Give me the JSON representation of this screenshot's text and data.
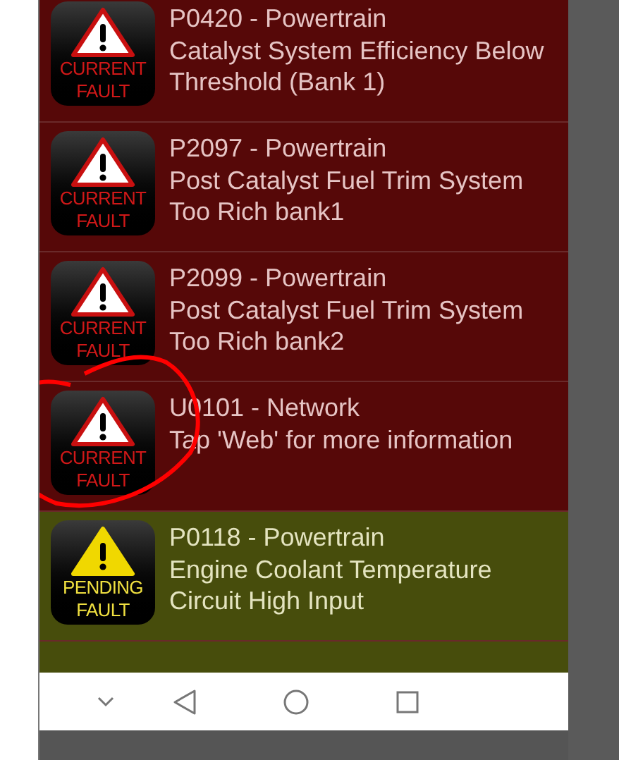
{
  "faults": [
    {
      "kind": "current",
      "badge": [
        "CURRENT",
        "FAULT"
      ],
      "title": "P0420 - Powertrain",
      "description": "Catalyst System Efficiency Below Threshold (Bank 1)",
      "circled": false
    },
    {
      "kind": "current",
      "badge": [
        "CURRENT",
        "FAULT"
      ],
      "title": "P2097 - Powertrain",
      "description": "Post Catalyst Fuel Trim System Too Rich bank1",
      "circled": false
    },
    {
      "kind": "current",
      "badge": [
        "CURRENT",
        "FAULT"
      ],
      "title": "P2099 - Powertrain",
      "description": "Post Catalyst Fuel Trim System Too Rich bank2",
      "circled": false
    },
    {
      "kind": "current",
      "badge": [
        "CURRENT",
        "FAULT"
      ],
      "title": "U0101 - Network",
      "description": "Tap 'Web' for more information",
      "circled": true
    },
    {
      "kind": "pending",
      "badge": [
        "PENDING",
        "FAULT"
      ],
      "title": "P0118 - Powertrain",
      "description": "Engine Coolant Temperature Circuit High Input",
      "circled": false
    }
  ],
  "partial_row": {
    "kind": "pending"
  }
}
